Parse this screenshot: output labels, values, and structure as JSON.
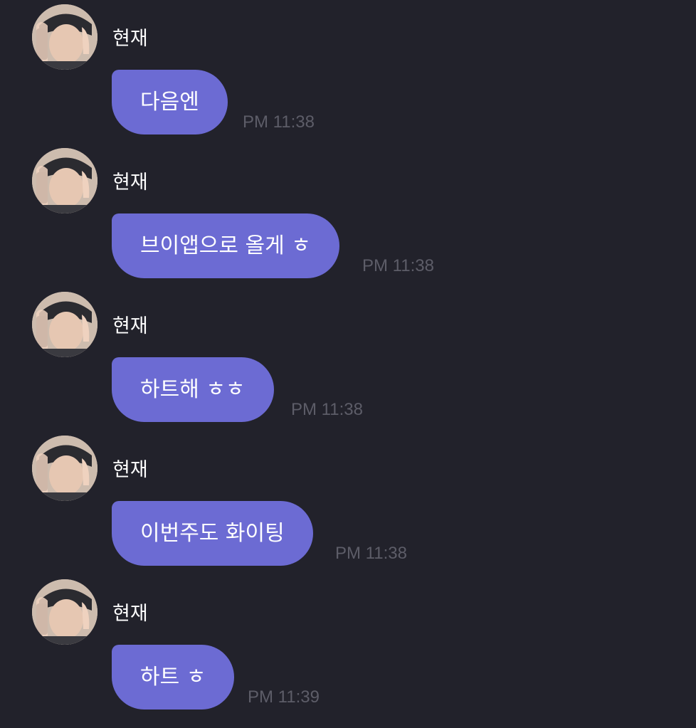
{
  "chat": {
    "messages": [
      {
        "sender": "현재",
        "text": "다음엔",
        "time": "PM 11:38"
      },
      {
        "sender": "현재",
        "text": "브이앱으로 올게 ㅎ",
        "time": "PM 11:38"
      },
      {
        "sender": "현재",
        "text": "하트해 ㅎㅎ",
        "time": "PM 11:38"
      },
      {
        "sender": "현재",
        "text": "이번주도 화이팅",
        "time": "PM 11:38"
      },
      {
        "sender": "현재",
        "text": "하트 ㅎ",
        "time": "PM 11:39"
      }
    ]
  },
  "colors": {
    "background": "#22222b",
    "bubble": "#6c6bd3",
    "timestamp": "#5d5d68"
  },
  "icons": {
    "avatar": "profile-photo"
  }
}
